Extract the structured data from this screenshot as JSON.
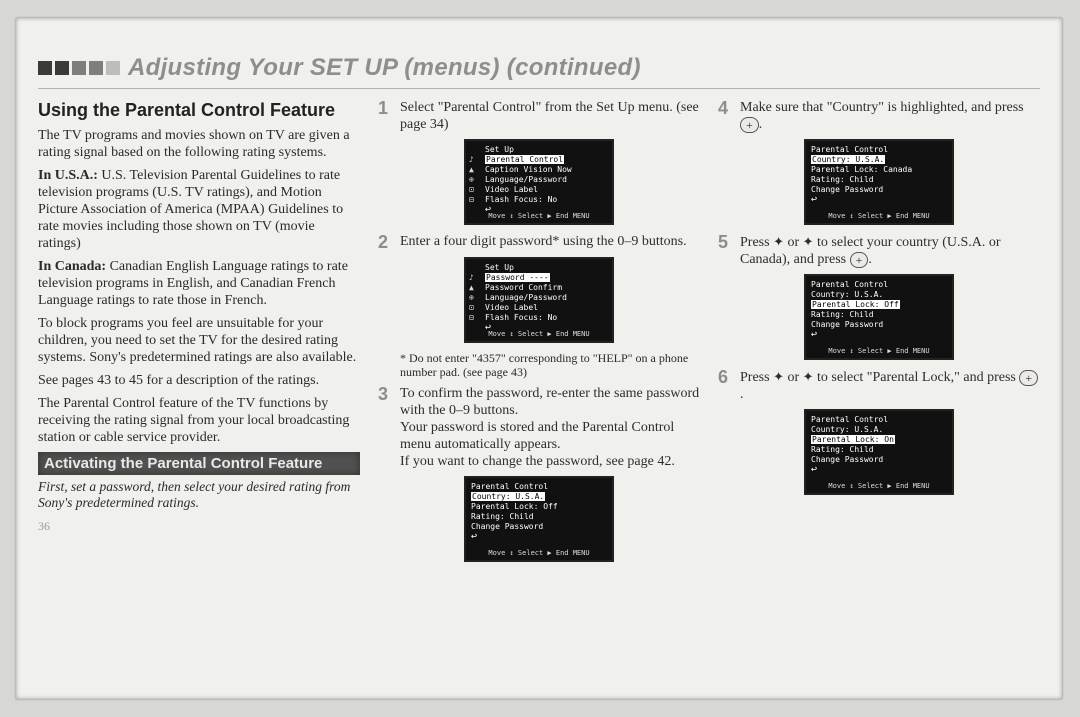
{
  "header": {
    "title": "Adjusting Your SET UP (menus) (continued)"
  },
  "left": {
    "section_title": "Using the Parental Control Feature",
    "p1": "The TV programs and movies shown on TV are given a rating signal based on the following rating systems.",
    "p2_lead": "In U.S.A.:",
    "p2": " U.S. Television Parental Guidelines to rate television programs (U.S. TV ratings), and Motion Picture Association of America (MPAA) Guidelines to rate movies including those shown on TV (movie ratings)",
    "p3_lead": "In Canada:",
    "p3": " Canadian English Language ratings to rate television programs in English, and Canadian French Language ratings to rate those in French.",
    "p4": "To block programs you feel are unsuitable for your children, you need to set the TV for the desired rating systems. Sony's predetermined ratings are also available.",
    "p5": "See pages 43 to 45 for a description of the ratings.",
    "p6": "The Parental Control feature of the TV functions by receiving the rating signal from your local broadcasting station or cable service provider.",
    "subhead": "Activating the Parental Control Feature",
    "intro": "First, set a password, then select your desired rating from Sony's predetermined ratings.",
    "page_num": "36"
  },
  "mid": {
    "step1": "Select \"Parental Control\" from the Set Up menu. (see page 34)",
    "osd1": {
      "title": "Set Up",
      "hl": "Parental Control",
      "l1": "Caption Vision  Now",
      "l2": "Language/Password",
      "l3": "Video Label",
      "l4": "Flash Focus:   No",
      "foot": "Move ↕   Select ▶   End  MENU"
    },
    "step2": "Enter a four digit password* using the 0–9 buttons.",
    "osd2": {
      "title": "Set Up",
      "hl": "Password  ----",
      "l1": "Password  Confirm",
      "l2": "Language/Password",
      "l3": "Video Label",
      "l4": "Flash Focus:   No",
      "foot": "Move ↕   Select ▶   End  MENU"
    },
    "note": "* Do not enter \"4357\" corresponding to \"HELP\" on a phone number pad. (see page 43)",
    "step3a": "To confirm the password, re-enter the same password with the 0–9 buttons.",
    "step3b": "Your password is stored and the Parental Control menu automatically appears.",
    "step3c": "If you want to change the password, see page 42.",
    "osd3": {
      "title": "Parental Control",
      "hl": "Country:   U.S.A.",
      "l1": "Parental Lock: Off",
      "l2": "Rating:      Child",
      "l3": "Change Password",
      "foot": "Move ↕   Select ▶   End  MENU"
    }
  },
  "right": {
    "step4a": "Make sure that \"Country\" is highlighted, and press ",
    "step4b": ".",
    "osd4": {
      "title": "Parental Control",
      "hl": "Country:   U.S.A.",
      "l1": "Parental Lock: Canada",
      "l2": "Rating:      Child",
      "l3": "Change Password",
      "foot": "Move ↕   Select ▶   End  MENU"
    },
    "step5a": "Press ",
    "step5b": " or ",
    "step5c": " to select your country (U.S.A. or Canada), and press ",
    "step5d": ".",
    "osd5": {
      "title": "Parental Control",
      "l0": "Country:   U.S.A.",
      "hl": "Parental Lock: Off",
      "l2": "Rating:      Child",
      "l3": "Change Password",
      "foot": "Move ↕   Select ▶   End  MENU"
    },
    "step6a": "Press ",
    "step6b": " or ",
    "step6c": " to select \"Parental Lock,\" and press ",
    "step6d": ".",
    "osd6": {
      "title": "Parental Control",
      "l0": "Country:   U.S.A.",
      "hl": "Parental Lock: On",
      "l2": "Rating:      Child",
      "l3": "Change Password",
      "foot": "Move ↕   Select ▶   End  MENU"
    }
  },
  "glyph": {
    "up": "✦",
    "down": "✦",
    "plus": "+"
  }
}
